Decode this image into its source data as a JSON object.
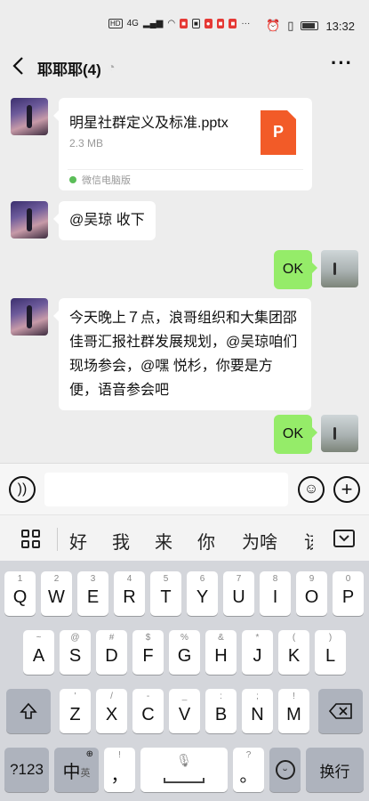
{
  "status": {
    "left_icons": [
      "HD",
      "4G",
      "signal-icon",
      "wifi-icon",
      "app-icon-1",
      "app-icon-2",
      "app-icon-3",
      "app-icon-4",
      "app-icon-5"
    ],
    "more": "···",
    "time": "13:32"
  },
  "header": {
    "title": "耶耶耶(4)",
    "more": "···"
  },
  "messages": {
    "file": {
      "name": "明星社群定义及标准.pptx",
      "size": "2.3 MB",
      "icon_letter": "P",
      "source": "微信电脑版"
    },
    "msg2": "@吴琼 收下",
    "msg3": "OK",
    "msg4": "今天晚上７点，浪哥组织和大集团邵佳哥汇报社群发展规划，@吴琼咱们现场参会，@嘿 悦杉，你要是方便，语音参会吧",
    "msg5": "OK"
  },
  "candidates": [
    "好",
    "我",
    "来",
    "你",
    "为啥",
    "该"
  ],
  "keyboard": {
    "row1": [
      {
        "top": "1",
        "main": "Q"
      },
      {
        "top": "2",
        "main": "W"
      },
      {
        "top": "3",
        "main": "E"
      },
      {
        "top": "4",
        "main": "R"
      },
      {
        "top": "5",
        "main": "T"
      },
      {
        "top": "6",
        "main": "Y"
      },
      {
        "top": "7",
        "main": "U"
      },
      {
        "top": "8",
        "main": "I"
      },
      {
        "top": "9",
        "main": "O"
      },
      {
        "top": "0",
        "main": "P"
      }
    ],
    "row2": [
      {
        "top": "~",
        "main": "A"
      },
      {
        "top": "@",
        "main": "S"
      },
      {
        "top": "#",
        "main": "D"
      },
      {
        "top": "$",
        "main": "F"
      },
      {
        "top": "%",
        "main": "G"
      },
      {
        "top": "&",
        "main": "H"
      },
      {
        "top": "*",
        "main": "J"
      },
      {
        "top": "(",
        "main": "K"
      },
      {
        "top": ")",
        "main": "L"
      }
    ],
    "row3": [
      {
        "top": "'",
        "main": "Z"
      },
      {
        "top": "/",
        "main": "X"
      },
      {
        "top": "-",
        "main": "C"
      },
      {
        "top": "_",
        "main": "V"
      },
      {
        "top": ":",
        "main": "B"
      },
      {
        "top": ";",
        "main": "N"
      },
      {
        "top": "!",
        "main": "M"
      }
    ],
    "num_key": "?123",
    "lang_key": "中",
    "lang_sub": "英",
    "comma_top": "!",
    "comma": "，",
    "period_top": "?",
    "period": "。",
    "enter": "换行"
  }
}
